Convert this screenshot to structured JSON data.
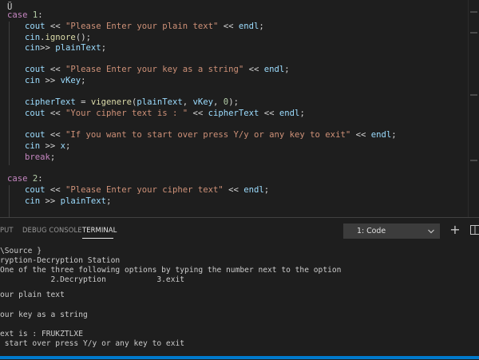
{
  "editor": {
    "cursor_marker": "Ü",
    "lines": [
      {
        "case_kw": "case",
        "case_num": "1",
        "colon": ":"
      },
      {
        "a": "cout",
        "b": " << ",
        "s": "\"Please Enter your plain text\"",
        "c": " << ",
        "d": "endl",
        "e": ";"
      },
      {
        "a": "cin",
        "b": ".",
        "f": "ignore",
        "c": "();"
      },
      {
        "a": "cin",
        "b": ">> ",
        "d": "plainText",
        "e": ";"
      },
      {
        "a": "cout",
        "b": " << ",
        "s": "\"Please Enter your key as a string\"",
        "c": " << ",
        "d": "endl",
        "e": ";"
      },
      {
        "a": "cin",
        "b": " >> ",
        "d": "vKey",
        "e": ";"
      },
      {
        "a": "cipherText",
        "b": " = ",
        "f": "vigenere",
        "p1": "(",
        "x1": "plainText",
        "p2": ", ",
        "x2": "vKey",
        "p3": ", ",
        "n": "0",
        "p4": ");"
      },
      {
        "a": "cout",
        "b": " << ",
        "s": "\"Your cipher text is : \"",
        "c": " << ",
        "x1": "cipherText",
        "c2": " << ",
        "d": "endl",
        "e": ";"
      },
      {
        "a": "cout",
        "b": " << ",
        "s": "\"If you want to start over press Y/y or any key to exit\"",
        "c": " << ",
        "d": "endl",
        "e": ";"
      },
      {
        "a": "cin",
        "b": " >> ",
        "d": "x",
        "e": ";"
      },
      {
        "k": "break",
        "e": ";"
      },
      {
        "case_kw": "case",
        "case_num": "2",
        "colon": ":"
      },
      {
        "a": "cout",
        "b": " << ",
        "s": "\"Please Enter your cipher text\"",
        "c": " << ",
        "d": "endl",
        "e": ";"
      },
      {
        "a": "cin",
        "b": " >> ",
        "d": "plainText",
        "e": ";"
      }
    ]
  },
  "panel": {
    "tabs": [
      "PUT",
      "DEBUG CONSOLE",
      "TERMINAL"
    ],
    "active_tab": "TERMINAL",
    "terminal_select": "1: Code",
    "new_terminal_symbol": "+"
  },
  "terminal": {
    "lines": [
      "\\Source }",
      "ryption-Decryption Station",
      "One of the three following options by typing the number next to the option",
      "           2.Decryption           3.exit",
      "",
      "our plain text",
      "",
      "our key as a string",
      "",
      "ext is : FRUKZTLXE",
      " start over press Y/y or any key to exit"
    ]
  },
  "colors": {
    "background": "#1e1e1e",
    "keyword": "#c586c0",
    "string": "#ce9178",
    "identifier": "#9cdcfe",
    "function": "#dcdcaa",
    "number": "#b5cea8",
    "statusbar": "#007acc"
  }
}
